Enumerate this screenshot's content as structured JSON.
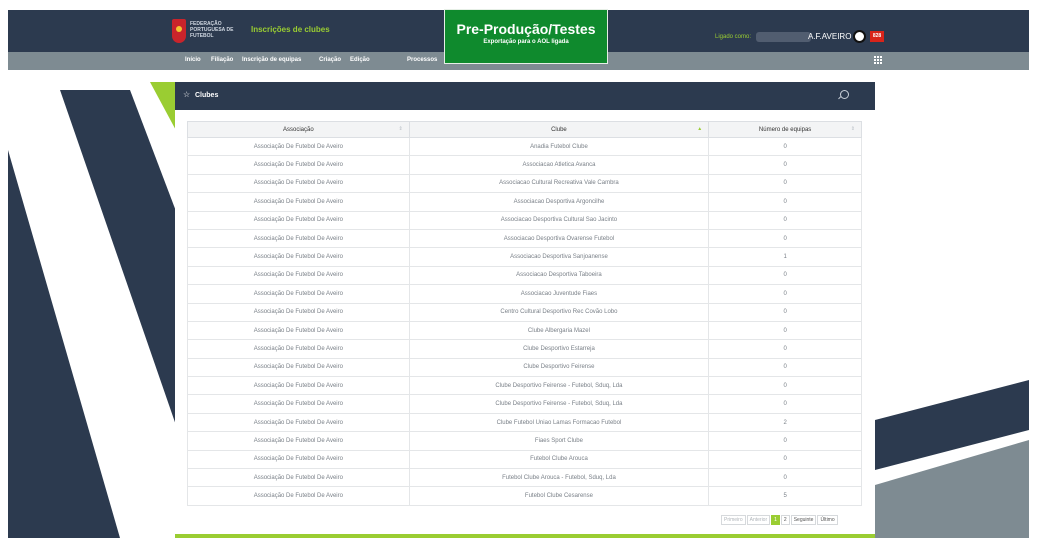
{
  "header": {
    "logo_text": "FEDERAÇÃO PORTUGUESA DE FUTEBOL",
    "app_title": "Inscrições de clubes",
    "environment": {
      "title": "Pre-Produção/Testes",
      "subtitle": "Exportação para o AOL ligada"
    },
    "logged_label": "Ligado como:",
    "user_name": "A.F.AVEIRO",
    "badge": "828"
  },
  "nav": {
    "items": [
      "Início",
      "Filiação",
      "Inscrição de equipas",
      "Criação",
      "Edição",
      "Processos"
    ]
  },
  "panel": {
    "title": "Clubes",
    "columns": [
      "Associação",
      "Clube",
      "Número de equipas"
    ],
    "rows": [
      [
        "Associação De Futebol De Aveiro",
        "Anadia Futebol Clube",
        "0"
      ],
      [
        "Associação De Futebol De Aveiro",
        "Associacao Atletica Avanca",
        "0"
      ],
      [
        "Associação De Futebol De Aveiro",
        "Associacao Cultural Recreativa Vale Cambra",
        "0"
      ],
      [
        "Associação De Futebol De Aveiro",
        "Associacao Desportiva Argoncilhe",
        "0"
      ],
      [
        "Associação De Futebol De Aveiro",
        "Associacao Desportiva Cultural Sao Jacinto",
        "0"
      ],
      [
        "Associação De Futebol De Aveiro",
        "Associacao Desportiva Ovarense Futebol",
        "0"
      ],
      [
        "Associação De Futebol De Aveiro",
        "Associacao Desportiva Sanjoanense",
        "1"
      ],
      [
        "Associação De Futebol De Aveiro",
        "Associacao Desportiva Taboeira",
        "0"
      ],
      [
        "Associação De Futebol De Aveiro",
        "Associacao Juventude Fiaes",
        "0"
      ],
      [
        "Associação De Futebol De Aveiro",
        "Centro Cultural Desportivo Rec Covão Lobo",
        "0"
      ],
      [
        "Associação De Futebol De Aveiro",
        "Clube Albergaria Mazel",
        "0"
      ],
      [
        "Associação De Futebol De Aveiro",
        "Clube Desportivo Estarreja",
        "0"
      ],
      [
        "Associação De Futebol De Aveiro",
        "Clube Desportivo Feirense",
        "0"
      ],
      [
        "Associação De Futebol De Aveiro",
        "Clube Desportivo Feirense - Futebol, Sduq, Lda",
        "0"
      ],
      [
        "Associação De Futebol De Aveiro",
        "Clube Desportivo Feirense - Futebol, Sduq, Lda",
        "0"
      ],
      [
        "Associação De Futebol De Aveiro",
        "Clube Futebol Uniao Lamas Formacao Futebol",
        "2"
      ],
      [
        "Associação De Futebol De Aveiro",
        "Fiaes Sport Clube",
        "0"
      ],
      [
        "Associação De Futebol De Aveiro",
        "Futebol Clube Arouca",
        "0"
      ],
      [
        "Associação De Futebol De Aveiro",
        "Futebol Clube Arouca - Futebol, Sduq, Lda",
        "0"
      ],
      [
        "Associação De Futebol De Aveiro",
        "Futebol Clube Cesarense",
        "5"
      ]
    ],
    "pager": {
      "first": "Primeiro",
      "prev": "Anterior",
      "pages": [
        "1",
        "2"
      ],
      "next": "Seguinte",
      "last": "Último"
    }
  },
  "colors": {
    "header_bg": "#2c3a4f",
    "nav_bg": "#7e8b92",
    "accent": "#9acd32",
    "env_green": "#0f8a2d",
    "badge_red": "#d9241a"
  }
}
